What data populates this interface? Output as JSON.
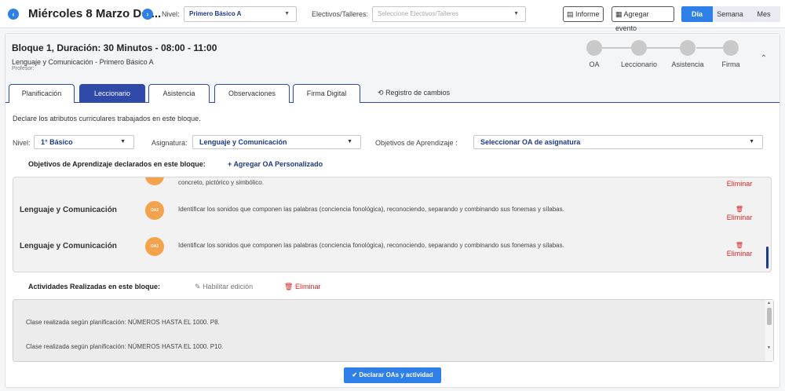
{
  "header": {
    "date_title": "Miércoles 8 Marzo De ...",
    "nivel_label": "Nivel:",
    "nivel_value": "Primero Básico A",
    "electivos_label": "Electivos/Talleres:",
    "electivos_placeholder": "Seleccione Electivos/Talleres",
    "informe_label": "Informe",
    "agregar_evento_label": "Agregar evento",
    "view_tabs": [
      "Día",
      "Semana",
      "Mes"
    ],
    "active_view": "Día"
  },
  "block": {
    "title": "Bloque 1, Duración: 30 Minutos - 08:00 - 11:00",
    "subject": "Lenguaje y Comunicación - Primero Básico A",
    "professor_label": "Profesor:",
    "steps": [
      "OA",
      "Leccionario",
      "Asistencia",
      "Firma"
    ]
  },
  "tabs": {
    "items": [
      "Planificación",
      "Leccionario",
      "Asistencia",
      "Observaciones",
      "Firma Digital"
    ],
    "active": "Leccionario",
    "history_label": "Registro de cambios"
  },
  "form": {
    "description": "Declare los atributos curriculares trabajados en este bloque.",
    "nivel_label": "Nivel:",
    "nivel_value": "1° Básico",
    "asignatura_label": "Asignatura:",
    "asignatura_value": "Lenguaje y Comunicación",
    "objetivos_label": "Objetivos de Aprendizaje :",
    "objetivos_value": "Seleccionar OA de asignatura"
  },
  "oa_section": {
    "title": "Objetivos de Aprendizaje declarados en este bloque:",
    "add_label": "Agregar OA Personalizado",
    "partial_text": "concreto, pictórico y simbólico.",
    "delete_label": "Eliminar",
    "rows": [
      {
        "subject": "Lenguaje y Comunicación",
        "badge": "OA2",
        "text": "Identificar los sonidos que componen las palabras (conciencia fonológica), reconociendo, separando y combinando sus fonemas y sílabas.",
        "delete_label": "Eliminar"
      },
      {
        "subject": "Lenguaje y Comunicación",
        "badge": "OA3",
        "text": "Identificar los sonidos que componen las palabras (conciencia fonológica), reconociendo, separando y combinando sus fonemas y sílabas.",
        "delete_label": "Eliminar"
      }
    ]
  },
  "activities": {
    "title": "Actividades Realizadas en este bloque:",
    "edit_label": "Habilitar edición",
    "delete_label": "Eliminar",
    "lines": [
      "Clase realizada según planificación: NÚMEROS HASTA EL 1000. P8.",
      "Clase realizada según planificación: NÚMEROS HASTA EL 1000. P10."
    ]
  },
  "submit_label": "Declarar OAs y actividad",
  "colors": {
    "primary": "#2f7fe8",
    "navy": "#2f4aa8",
    "badge_orange": "#f4a24c",
    "danger": "#d62424"
  },
  "icons": {
    "prev": "chevron-left-icon",
    "next": "chevron-right-icon",
    "informe": "document-icon",
    "evento": "calendar-icon",
    "history": "history-icon",
    "add": "plus-icon",
    "edit": "pencil-icon",
    "delete": "trash-icon",
    "collapse": "chevron-up-icon",
    "submit": "check-icon"
  }
}
